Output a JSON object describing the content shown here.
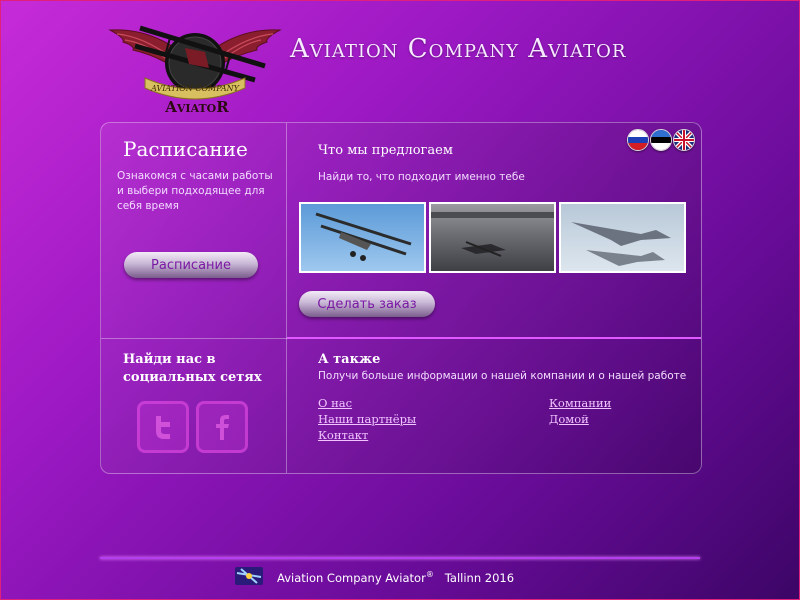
{
  "header": {
    "title": "Aviation Company Aviator",
    "logo_ribbon": "AVIATION COMPANY",
    "logo_name": "AviatoR"
  },
  "languages": [
    "ru",
    "ee",
    "en"
  ],
  "schedule": {
    "title": "Расписание",
    "text": "Ознакомся с часами работы и выбери подходящее для себя время",
    "button": "Расписание"
  },
  "offer": {
    "title": "Что мы предлогаем",
    "subtitle": "Найди то, что подходит именно тебе",
    "photos": [
      "biplane-in-sky",
      "propeller-plane-on-runway",
      "jet-fighters-in-flight"
    ],
    "order_button": "Сделать заказ"
  },
  "social": {
    "title": "Найди нас в социальных сетях",
    "items": [
      "twitter-icon",
      "facebook-icon"
    ]
  },
  "also": {
    "title": "А также",
    "subtitle": "Получи больше информации о нашей компании и о нашей работе",
    "links_left": [
      "О нас",
      "Наши партнёры",
      "Контакт"
    ],
    "links_right": [
      "Компании ",
      "Домой"
    ]
  },
  "footer": {
    "text": "Aviation Company Aviator",
    "mark": "®",
    "tail": "Tallinn 2016"
  }
}
